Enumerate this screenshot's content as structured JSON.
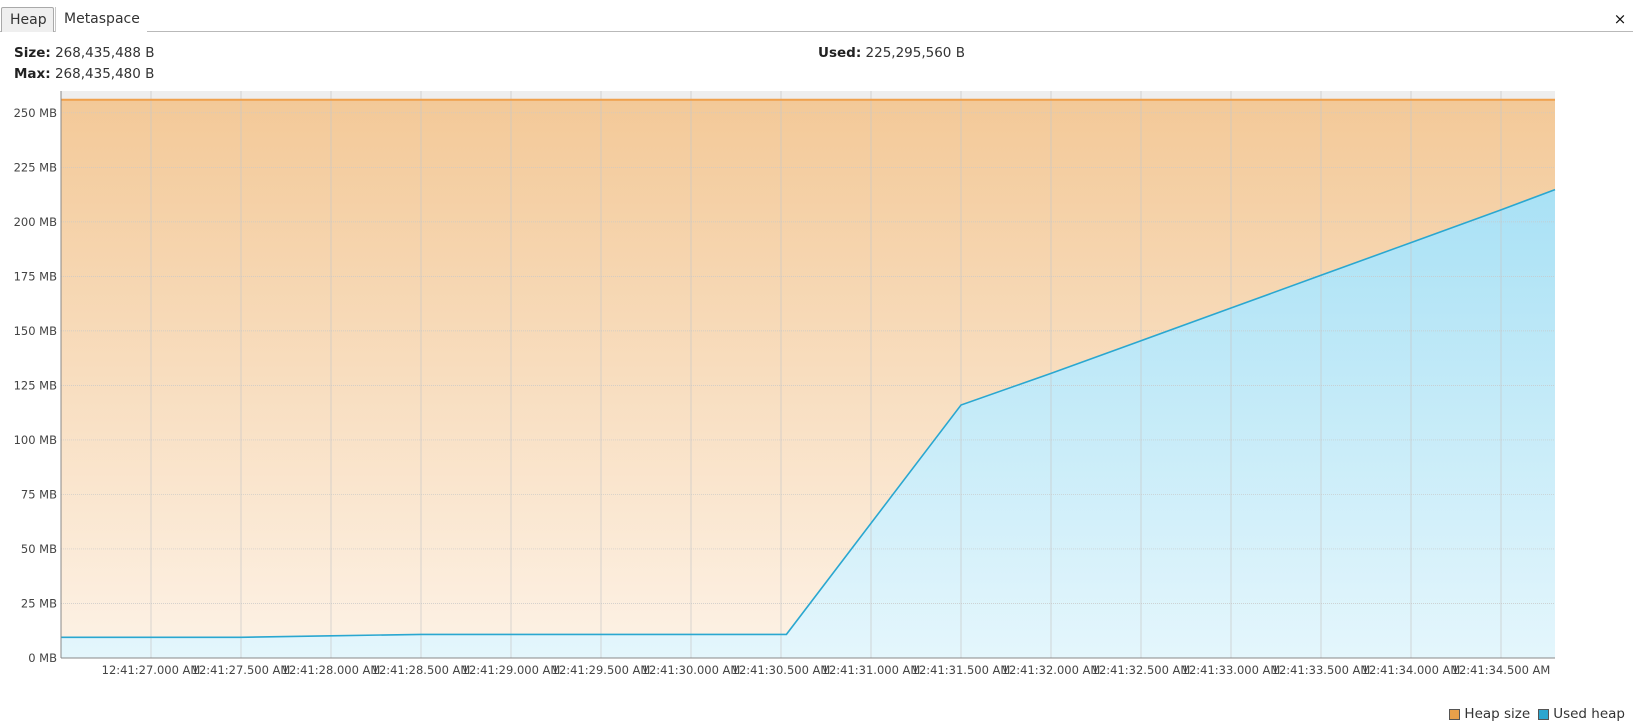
{
  "tabs": [
    {
      "label": "Heap",
      "active": true
    },
    {
      "label": "Metaspace",
      "active": false
    }
  ],
  "close_label": "×",
  "stats": {
    "size_label": "Size:",
    "size_value": "268,435,488 B",
    "max_label": "Max:",
    "max_value": "268,435,480 B",
    "used_label": "Used:",
    "used_value": "225,295,560 B"
  },
  "legend": [
    {
      "label": "Heap size",
      "color": "#e8a04a"
    },
    {
      "label": "Used heap",
      "color": "#2ba6cf"
    }
  ],
  "colors": {
    "heap_line": "#f0a04b",
    "used_line": "#2aa7d0",
    "heap_fill_top": "#f3c998",
    "heap_fill_bottom": "#fdf2e6",
    "used_fill_top": "#a9e1f5",
    "used_fill_bottom": "#e4f6fc",
    "grid": "#c8c8c8",
    "plot_bg": "#eeeeee"
  },
  "chart_data": {
    "type": "area",
    "title": "",
    "xlabel": "",
    "ylabel": "",
    "unit": "MB",
    "ylim": [
      0,
      260
    ],
    "y_ticks": [
      0,
      25,
      50,
      75,
      100,
      125,
      150,
      175,
      200,
      225,
      250
    ],
    "y_tick_labels": [
      "0 MB",
      "25 MB",
      "50 MB",
      "75 MB",
      "100 MB",
      "125 MB",
      "150 MB",
      "175 MB",
      "200 MB",
      "225 MB",
      "250 MB"
    ],
    "x_start": "12:41:26.500 AM",
    "x_end": "12:41:34.800 AM",
    "xlim_seconds": [
      26.5,
      34.8
    ],
    "x_ticks_seconds": [
      27.0,
      27.5,
      28.0,
      28.5,
      29.0,
      29.5,
      30.0,
      30.5,
      31.0,
      31.5,
      32.0,
      32.5,
      33.0,
      33.5,
      34.0,
      34.5
    ],
    "x_tick_labels": [
      "12:41:27.000 AM",
      "12:41:27.500 AM",
      "12:41:28.000 AM",
      "12:41:28.500 AM",
      "12:41:29.000 AM",
      "12:41:29.500 AM",
      "12:41:30.000 AM",
      "12:41:30.500 AM",
      "12:41:31.000 AM",
      "12:41:31.500 AM",
      "12:41:32.000 AM",
      "12:41:32.500 AM",
      "12:41:33.000 AM",
      "12:41:33.500 AM",
      "12:41:34.000 AM",
      "12:41:34.500 AM"
    ],
    "grid": true,
    "legend_position": "bottom-right",
    "series": [
      {
        "name": "Heap size",
        "x": [
          26.5,
          34.8
        ],
        "y": [
          256,
          256
        ]
      },
      {
        "name": "Used heap",
        "x": [
          26.5,
          27.0,
          27.5,
          28.0,
          28.5,
          29.0,
          29.5,
          30.0,
          30.5,
          30.53,
          31.5,
          32.0,
          32.5,
          33.0,
          33.5,
          34.0,
          34.5,
          34.8
        ],
        "y": [
          9.5,
          9.5,
          9.5,
          10.2,
          10.8,
          10.8,
          10.8,
          10.8,
          10.8,
          10.8,
          116,
          130.5,
          145.5,
          160.5,
          175.5,
          190.5,
          205.5,
          214.8
        ]
      }
    ]
  }
}
